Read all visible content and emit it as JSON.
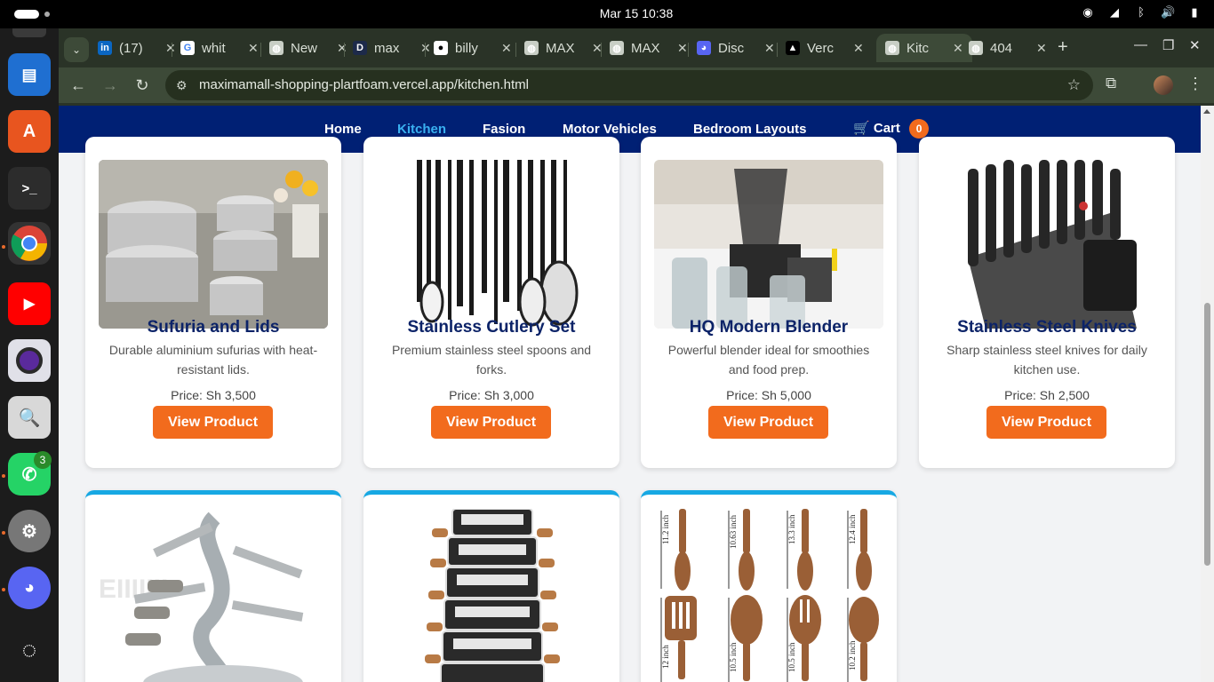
{
  "system": {
    "clock": "Mar 15  10:38",
    "whatsapp_badge": "3"
  },
  "browser": {
    "tabs": [
      {
        "icon": "linkedin-icon",
        "title": "(17)"
      },
      {
        "icon": "google-icon",
        "title": "whit"
      },
      {
        "icon": "globe-icon",
        "title": "New"
      },
      {
        "icon": "d-icon",
        "title": "max"
      },
      {
        "icon": "github-icon",
        "title": "billy"
      },
      {
        "icon": "globe-icon",
        "title": "MAX"
      },
      {
        "icon": "globe-icon",
        "title": "MAX"
      },
      {
        "icon": "discord-icon",
        "title": "Disc"
      },
      {
        "icon": "vercel-icon",
        "title": "Verc"
      },
      {
        "icon": "globe-icon",
        "title": "Kitc"
      },
      {
        "icon": "globe-icon",
        "title": "404"
      }
    ],
    "url": "maximamall-shopping-plartfoam.vercel.app/kitchen.html"
  },
  "site": {
    "nav": {
      "home": "Home",
      "kitchen": "Kitchen",
      "fashion": "Fasion",
      "motor": "Motor Vehicles",
      "bedroom": "Bedroom Layouts",
      "cart": "Cart",
      "cart_count": "0"
    },
    "products": [
      {
        "name": "Sufuria and Lids",
        "desc": "Durable aluminium sufurias with heat-resistant lids.",
        "price": "Price: Sh 3,500",
        "button": "View Product"
      },
      {
        "name": "Stainless Cutlery Set",
        "desc": "Premium stainless steel spoons and forks.",
        "price": "Price: Sh 3,000",
        "button": "View Product"
      },
      {
        "name": "HQ Modern Blender",
        "desc": "Powerful blender ideal for smoothies and food prep.",
        "price": "Price: Sh 5,000",
        "button": "View Product"
      },
      {
        "name": "Stainless Steel Knives",
        "desc": "Sharp stainless steel knives for daily kitchen use.",
        "price": "Price: Sh 2,500",
        "button": "View Product"
      }
    ],
    "spoon_labels": [
      "11.2 inch",
      "10.63 inch",
      "13.3 inch",
      "12.4 inch",
      "12 inch",
      "10.5 inch",
      "10.5 inch",
      "10.2 inch"
    ]
  }
}
